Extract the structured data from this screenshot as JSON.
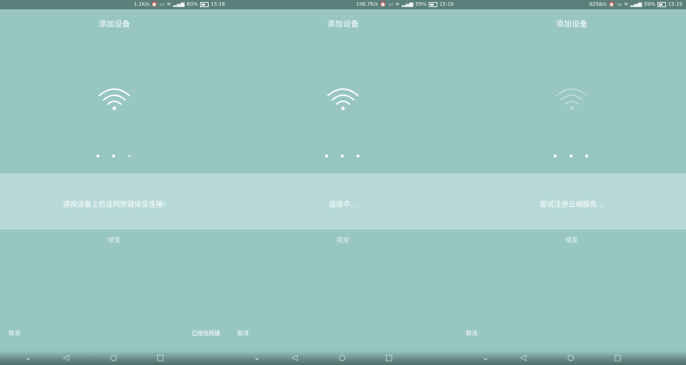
{
  "colors": {
    "background": "#98c6c2",
    "band": "#b6d9d8",
    "statusbar": "#5b807c",
    "text": "#ffffff"
  },
  "status_icons": [
    "alarm-icon",
    "hd-icon",
    "wifi-icon",
    "4g-icon",
    "signal-icon",
    "battery-icon"
  ],
  "screens": [
    {
      "status": {
        "speed": "1.1K/s",
        "battery": "60%",
        "time": "15:16"
      },
      "title": "添加设备",
      "message": "请按设备上的连网按键接受连接!",
      "sub_label": "喂爱",
      "cancel": "取消",
      "confirm": "已按连网键",
      "wifi_icon": "wifi-icon",
      "wifi_faded": false,
      "dots_active": [
        true,
        true,
        false
      ]
    },
    {
      "status": {
        "speed": "198.7K/s",
        "battery": "59%",
        "time": "15:18"
      },
      "title": "添加设备",
      "message": "连接中...",
      "sub_label": "喂爱",
      "cancel": "取消",
      "wifi_icon": "wifi-icon",
      "wifi_faded": false,
      "dots_active": [
        true,
        true,
        true
      ]
    },
    {
      "status": {
        "speed": "825B/s",
        "battery": "59%",
        "time": "15:19"
      },
      "title": "添加设备",
      "message": "尝试注册云端服务...",
      "sub_label": "喂爱",
      "cancel": "取消",
      "wifi_icon": "wifi-icon",
      "wifi_faded": true,
      "dots_active": [
        true,
        true,
        true
      ]
    }
  ],
  "navbar": {
    "hide": "⌄",
    "back": "◁",
    "home": "○",
    "recent": "□"
  }
}
